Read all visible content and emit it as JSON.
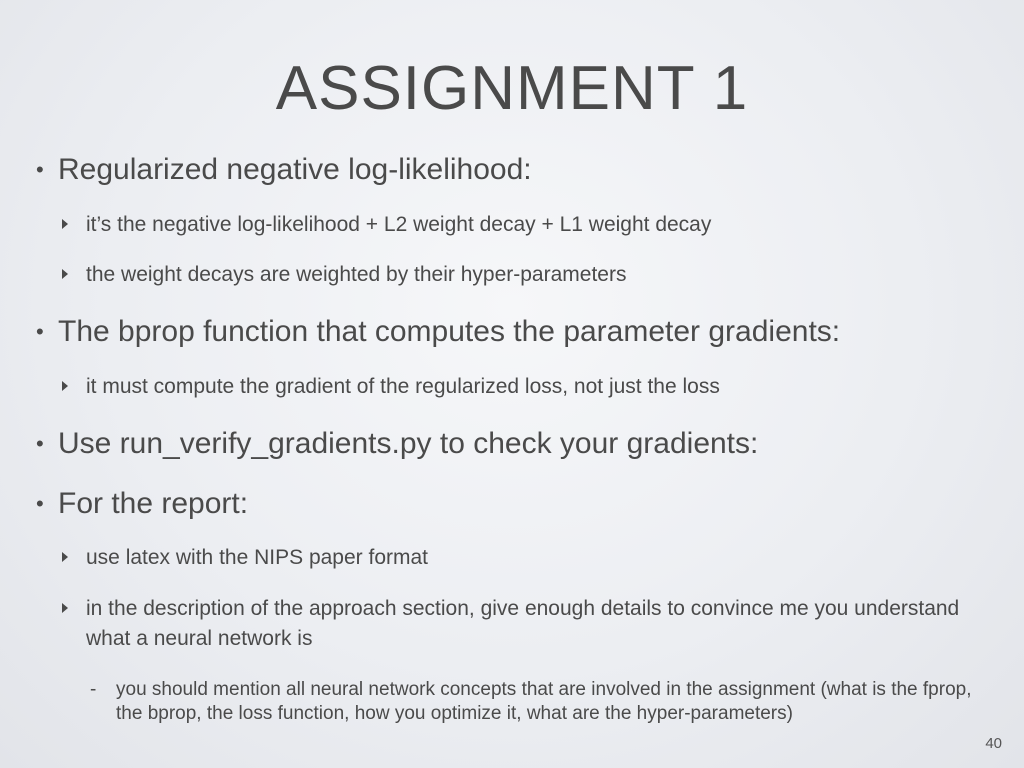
{
  "slide": {
    "title": "ASSIGNMENT 1",
    "page_number": "40",
    "bullets": [
      {
        "text": "Regularized negative log-likelihood:",
        "subs": [
          "it’s the negative log-likelihood + L2 weight decay + L1 weight decay",
          "the weight decays are weighted by their hyper-parameters"
        ]
      },
      {
        "text": "The bprop function that computes the parameter gradients:",
        "subs": [
          "it must compute the gradient of the regularized loss, not just the loss"
        ]
      },
      {
        "text": "Use run_verify_gradients.py to check your gradients:",
        "subs": []
      },
      {
        "text": "For the report:",
        "subs": [
          "use latex with the NIPS paper format",
          "in the description of the approach section, give enough details to convince me you understand what a neural network is"
        ],
        "subsubs": [
          "you should mention all neural network concepts that are involved in the assignment (what is the fprop, the bprop, the loss function, how you optimize it, what are the hyper-parameters)"
        ]
      }
    ]
  }
}
